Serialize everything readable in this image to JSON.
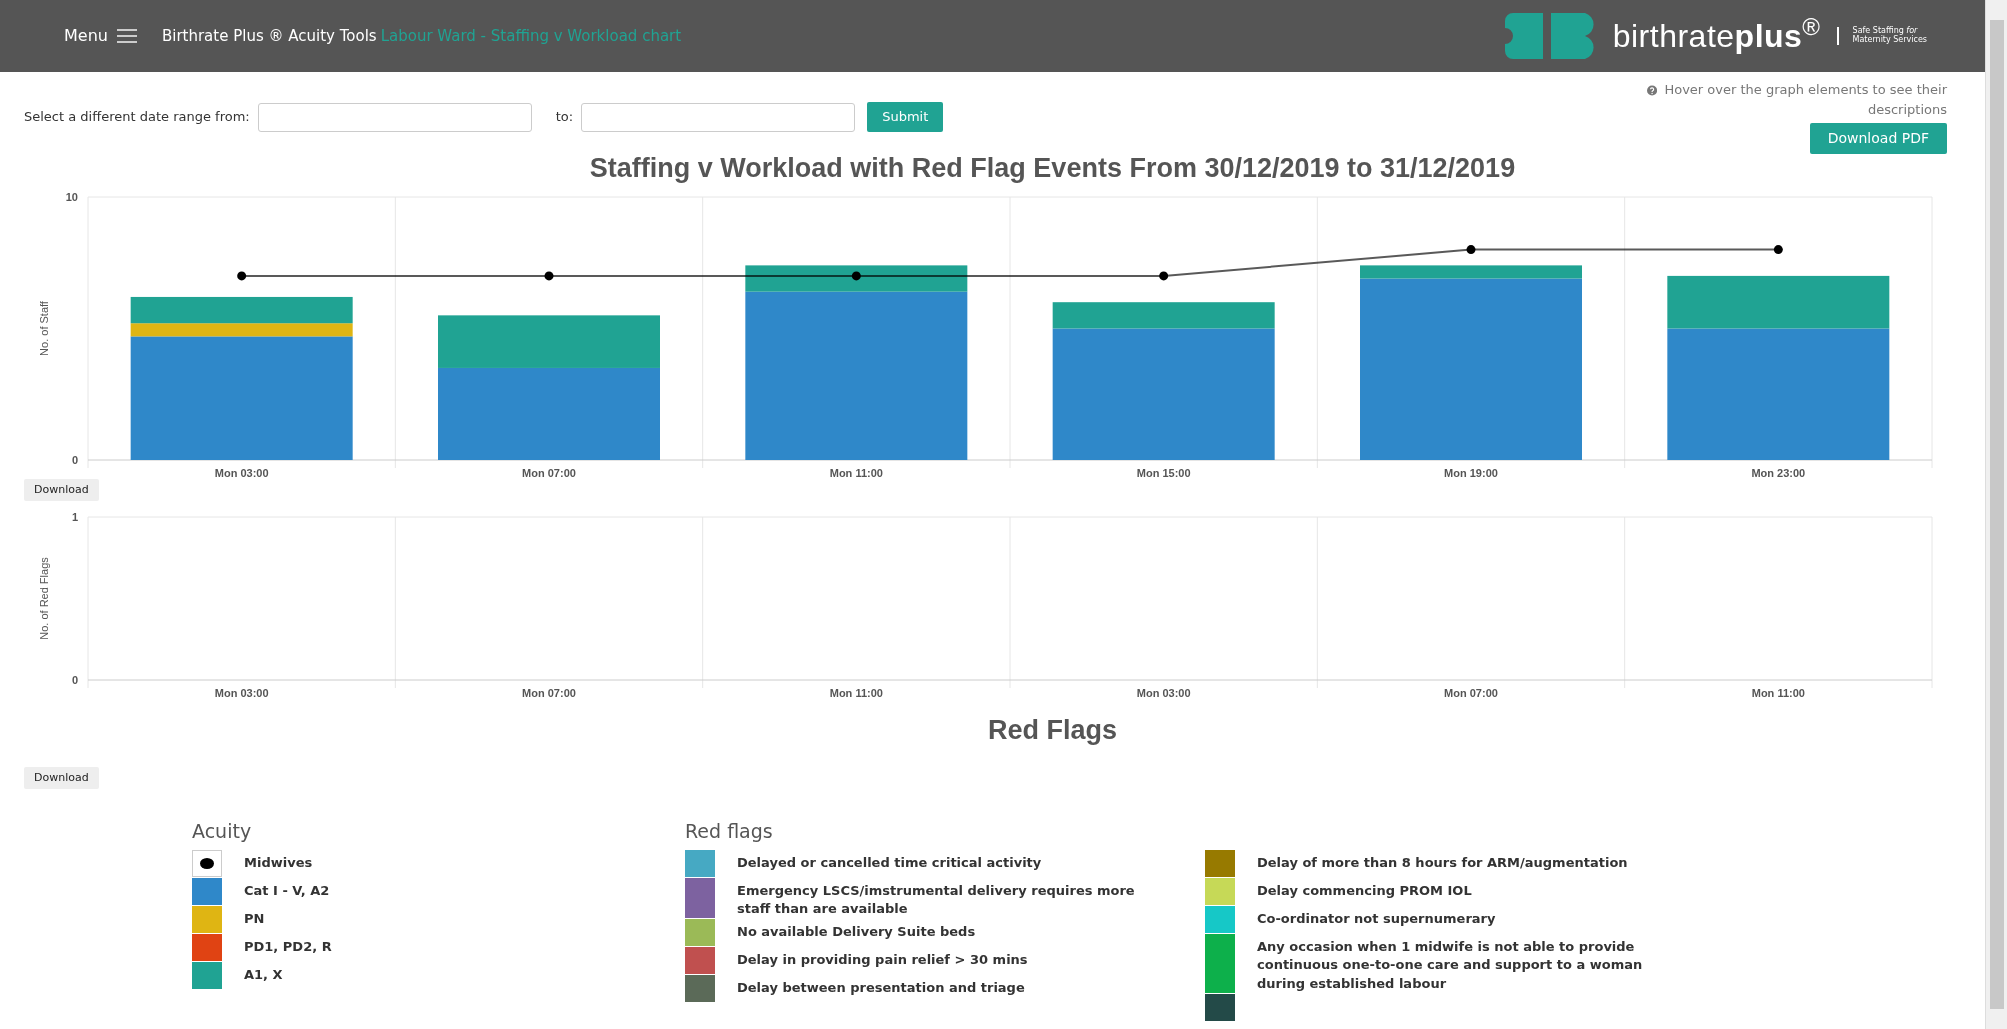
{
  "header": {
    "menu_label": "Menu",
    "app_title": "Birthrate Plus ® Acuity Tools",
    "page_title": "Labour Ward - Staffing v Workload chart",
    "brand": "birthrate**plus**$^{®}$",
    "tagline_lines": [
      "Safe Staffing *for*",
      "Maternity Services"
    ]
  },
  "date_range": {
    "from_label": "Select a different date range from:",
    "to_label": "to:",
    "submit": "Submit"
  },
  "hint": "Hover over the graph elements to see their descriptions",
  "download_pdf": "Download PDF",
  "staffing_chart": {
    "chart_data": {
      "type": "bar",
      "stacked": true,
      "title": "Staffing v Workload with Red Flag Events From 30/12/2019 to 31/12/2019",
      "ylabel": "No. of Staff",
      "categories": [
        "Mon 03:00",
        "Mon 07:00",
        "Mon 11:00",
        "Mon 15:00",
        "Mon 19:00",
        "Mon 23:00"
      ],
      "ylim": [
        0,
        10
      ],
      "yticks": [
        0,
        10
      ],
      "series": [
        {
          "name": "Midwives",
          "type": "line",
          "marker": true,
          "color": "#000000",
          "values": [
            7,
            7,
            7,
            7,
            8,
            8
          ]
        },
        {
          "name": "Cat I - V, A2",
          "type": "bar",
          "color": "#2f88c9",
          "values": [
            4.7,
            3.5,
            6.4,
            5.0,
            6.9,
            5.0
          ]
        },
        {
          "name": "PN",
          "type": "bar",
          "color": "#dfb513",
          "values": [
            0.5,
            0,
            0,
            0,
            0,
            0
          ]
        },
        {
          "name": "PD1, PD2, R",
          "type": "bar",
          "color": "#e04313",
          "values": [
            0,
            0,
            0,
            0,
            0,
            0
          ]
        },
        {
          "name": "A1, X",
          "type": "bar",
          "color": "#20a393",
          "values": [
            1.0,
            2.0,
            1.0,
            1.0,
            0.5,
            2.0
          ]
        }
      ]
    },
    "download": "Download"
  },
  "red_flag_chart": {
    "chart_data": {
      "type": "bar",
      "title": "Red Flags",
      "ylabel": "No. of Red Flags",
      "categories": [
        "Mon 03:00",
        "Mon 07:00",
        "Mon 11:00",
        "Mon 03:00",
        "Mon 07:00",
        "Mon 11:00"
      ],
      "ylim": [
        0,
        1
      ],
      "yticks": [
        0,
        1
      ]
    },
    "download": "Download"
  },
  "legend": {
    "acuity": {
      "heading": "Acuity"
    },
    "red_flags": {
      "heading": "Red flags",
      "columns": [
        [
          {
            "kind": "swatch",
            "label": "Delayed or cancelled time critical activity",
            "color": "#46a9c3"
          },
          {
            "kind": "swatch",
            "label": "Emergency LSCS/imstrumental delivery requires more staff than are available",
            "color": "#7d62a0"
          },
          {
            "kind": "swatch",
            "label": "No available Delivery Suite beds",
            "color": "#9bba57"
          },
          {
            "kind": "swatch",
            "label": "Delay in providing pain relief > 30 mins",
            "color": "#c0504f"
          },
          {
            "kind": "swatch",
            "label": "Delay between presentation and triage",
            "color": "#5b6a58"
          }
        ],
        [
          {
            "kind": "swatch",
            "label": "Delay of more than 8 hours for ARM/augmentation",
            "color": "#977a00"
          },
          {
            "kind": "swatch",
            "label": "Delay commencing PROM IOL",
            "color": "#c6d957"
          },
          {
            "kind": "swatch",
            "label": "Co-ordinator not supernumerary",
            "color": "#16c8c7"
          },
          {
            "kind": "swatch",
            "label": "Any occasion when 1 midwife is not able to provide continuous one-to-one care and support to a woman during established labour",
            "color": "#0db04b"
          },
          {
            "kind": "swatch",
            "color": "#234a48"
          }
        ]
      ]
    }
  }
}
